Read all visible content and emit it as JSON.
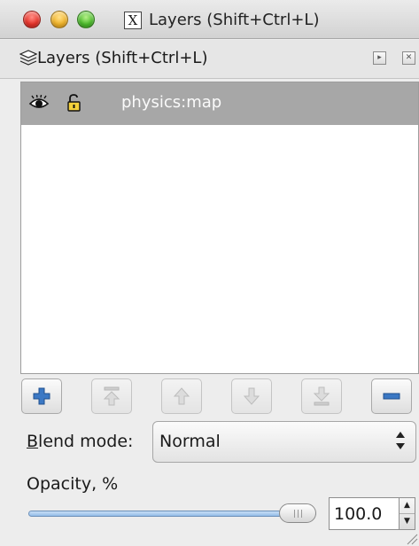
{
  "window": {
    "title": "Layers (Shift+Ctrl+L)"
  },
  "dock": {
    "title": "Layers (Shift+Ctrl+L)"
  },
  "layers": [
    {
      "name": "physics:map",
      "visible": true,
      "locked": false,
      "selected": true
    }
  ],
  "toolbar": {
    "buttons": [
      "add-layer",
      "raise-to-top",
      "raise",
      "lower",
      "lower-to-bottom",
      "remove-layer"
    ]
  },
  "blend": {
    "label": "Blend mode:",
    "value": "Normal"
  },
  "opacity": {
    "label": "Opacity, %",
    "value": "100.0",
    "fraction": 1.0
  },
  "colors": {
    "selection": "#a7a7a7",
    "accent_blue": "#3b78c4",
    "slider_blue": "#8db6e3"
  }
}
